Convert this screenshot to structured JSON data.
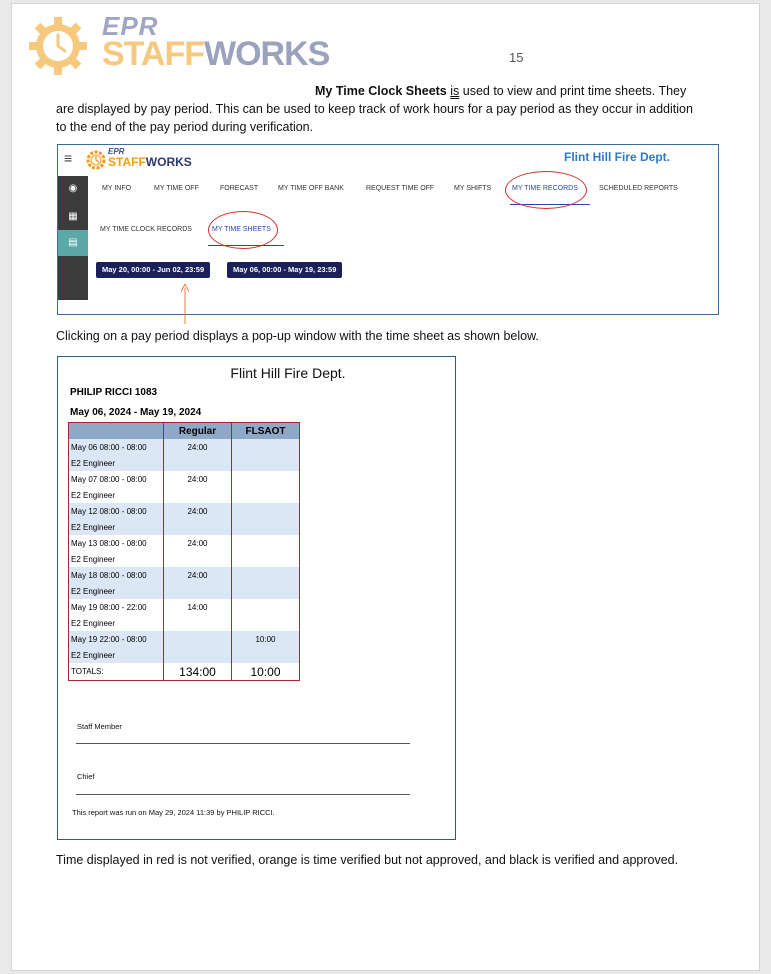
{
  "logo": {
    "epr": "EPR",
    "brand_a": "STAFF",
    "brand_b": "WORKS",
    "colors": {
      "gear": "#f6c97f",
      "text": "#9aa2bd"
    }
  },
  "page_number": "15",
  "intro": {
    "bold": "My Time Clock Sheets",
    "is": "is",
    "rest_line1": " used to view and print time sheets. They",
    "line2": "are displayed by pay period. This can be used to keep track of work hours for a pay period as they occur in addition",
    "line3": "to the end of the pay period during verification."
  },
  "app": {
    "logo_epr": "EPR",
    "logo_a": "STAFF",
    "logo_b": "WORKS",
    "dept": "Flint Hill Fire Dept.",
    "tabs": [
      "MY INFO",
      "MY TIME OFF",
      "FORECAST",
      "MY TIME OFF BANK",
      "REQUEST TIME OFF",
      "MY SHIFTS",
      "MY TIME RECORDS",
      "SCHEDULED REPORTS"
    ],
    "subtabs": [
      "MY TIME CLOCK RECORDS",
      "MY TIME SHEETS"
    ],
    "periods": [
      "May 20, 00:00 - Jun 02, 23:59",
      "May 06, 00:00 - May 19, 23:59"
    ],
    "icons": [
      "dashboard-icon",
      "calendar-icon",
      "id-card-icon"
    ]
  },
  "caption": "Clicking on a pay period displays a pop-up window with the time sheet as shown below.",
  "timesheet": {
    "title": "Flint Hill Fire Dept.",
    "employee": "PHILIP RICCI 1083",
    "period": "May 06, 2024 - May 19, 2024",
    "columns": [
      "",
      "Regular",
      "FLSAOT"
    ],
    "rows": [
      {
        "date": "May 06 08:00 - 08:00",
        "role": "E2 Engineer",
        "regular": "24:00",
        "flsaot": ""
      },
      {
        "date": "May 07 08:00 - 08:00",
        "role": "E2 Engineer",
        "regular": "24:00",
        "flsaot": ""
      },
      {
        "date": "May 12 08:00 - 08:00",
        "role": "E2 Engineer",
        "regular": "24:00",
        "flsaot": ""
      },
      {
        "date": "May 13 08:00 - 08:00",
        "role": "E2 Engineer",
        "regular": "24:00",
        "flsaot": ""
      },
      {
        "date": "May 18 08:00 - 08:00",
        "role": "E2 Engineer",
        "regular": "24:00",
        "flsaot": ""
      },
      {
        "date": "May 19 08:00 - 22:00",
        "role": "E2 Engineer",
        "regular": "14:00",
        "flsaot": ""
      },
      {
        "date": "May 19 22:00 - 08:00",
        "role": "E2 Engineer",
        "regular": "",
        "flsaot": "10:00"
      }
    ],
    "totals": {
      "label": "TOTALS:",
      "regular": "134:00",
      "flsaot": "10:00"
    },
    "staff_label": "Staff Member",
    "chief_label": "Chief",
    "run_note": "This report was run on May 29, 2024 11:39 by PHILIP RICCI."
  },
  "footer_note": "Time displayed in red is not verified, orange is time verified but not approved, and black is verified and approved."
}
